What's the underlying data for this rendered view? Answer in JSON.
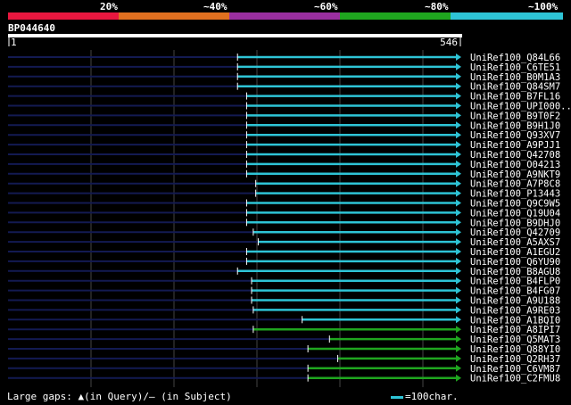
{
  "colors": {
    "seg_red": "#e8173f",
    "seg_orange": "#e07020",
    "seg_purple": "#9a2fa0",
    "seg_green": "#1fa61f",
    "seg_cyan": "#2ec4d6",
    "query_line": "#ffffff",
    "faint_line": "#131a52",
    "hit_cyan": "#2ec4d6",
    "hit_green": "#1fa61f",
    "grid": "#444444"
  },
  "scale": {
    "labels": [
      "20%",
      "~40%",
      "~60%",
      "~80%",
      "~100%"
    ]
  },
  "query": {
    "id": "BP044640",
    "start_label": "1",
    "end_label": "546",
    "length": 546
  },
  "hits": [
    {
      "name": "UniRef100_Q84L66",
      "start": 277,
      "end": 546,
      "color": "cyan"
    },
    {
      "name": "UniRef100_C6TE51",
      "start": 277,
      "end": 546,
      "color": "cyan"
    },
    {
      "name": "UniRef100_B0M1A3",
      "start": 277,
      "end": 546,
      "color": "cyan"
    },
    {
      "name": "UniRef100_Q84SM7",
      "start": 277,
      "end": 546,
      "color": "cyan"
    },
    {
      "name": "UniRef100_B7FL16",
      "start": 288,
      "end": 546,
      "color": "cyan"
    },
    {
      "name": "UniRef100_UPI000..",
      "start": 288,
      "end": 546,
      "color": "cyan"
    },
    {
      "name": "UniRef100_B9T0F2",
      "start": 288,
      "end": 546,
      "color": "cyan"
    },
    {
      "name": "UniRef100_B9H1J0",
      "start": 288,
      "end": 546,
      "color": "cyan"
    },
    {
      "name": "UniRef100_Q93XV7",
      "start": 288,
      "end": 546,
      "color": "cyan"
    },
    {
      "name": "UniRef100_A9PJJ1",
      "start": 288,
      "end": 546,
      "color": "cyan"
    },
    {
      "name": "UniRef100_Q42708",
      "start": 288,
      "end": 546,
      "color": "cyan"
    },
    {
      "name": "UniRef100_O04213",
      "start": 288,
      "end": 546,
      "color": "cyan"
    },
    {
      "name": "UniRef100_A9NKT9",
      "start": 288,
      "end": 546,
      "color": "cyan"
    },
    {
      "name": "UniRef100_A7P8C8",
      "start": 299,
      "end": 546,
      "color": "cyan"
    },
    {
      "name": "UniRef100_P13443",
      "start": 299,
      "end": 546,
      "color": "cyan"
    },
    {
      "name": "UniRef100_Q9C9W5",
      "start": 288,
      "end": 546,
      "color": "cyan"
    },
    {
      "name": "UniRef100_Q19U04",
      "start": 288,
      "end": 546,
      "color": "cyan"
    },
    {
      "name": "UniRef100_B9DHJ0",
      "start": 288,
      "end": 546,
      "color": "cyan"
    },
    {
      "name": "UniRef100_Q42709",
      "start": 296,
      "end": 546,
      "color": "cyan"
    },
    {
      "name": "UniRef100_A5AXS7",
      "start": 302,
      "end": 546,
      "color": "cyan"
    },
    {
      "name": "UniRef100_A1EGU2",
      "start": 288,
      "end": 546,
      "color": "cyan"
    },
    {
      "name": "UniRef100_Q6YU90",
      "start": 288,
      "end": 546,
      "color": "cyan"
    },
    {
      "name": "UniRef100_B8AGU8",
      "start": 277,
      "end": 546,
      "color": "cyan"
    },
    {
      "name": "UniRef100_B4FLP0",
      "start": 294,
      "end": 546,
      "color": "cyan"
    },
    {
      "name": "UniRef100_B4FG07",
      "start": 294,
      "end": 546,
      "color": "cyan"
    },
    {
      "name": "UniRef100_A9U188",
      "start": 294,
      "end": 546,
      "color": "cyan"
    },
    {
      "name": "UniRef100_A9RE03",
      "start": 296,
      "end": 546,
      "color": "cyan"
    },
    {
      "name": "UniRef100_A1BQI0",
      "start": 355,
      "end": 546,
      "color": "cyan"
    },
    {
      "name": "UniRef100_A8IPI7",
      "start": 296,
      "end": 546,
      "color": "green"
    },
    {
      "name": "UniRef100_Q5MAT3",
      "start": 388,
      "end": 546,
      "color": "green"
    },
    {
      "name": "UniRef100_Q88YI0",
      "start": 362,
      "end": 546,
      "color": "green"
    },
    {
      "name": "UniRef100_Q2RH37",
      "start": 398,
      "end": 546,
      "color": "green"
    },
    {
      "name": "UniRef100_C6VM87",
      "start": 362,
      "end": 546,
      "color": "green"
    },
    {
      "name": "UniRef100_C2FMU8",
      "start": 362,
      "end": 546,
      "color": "green"
    }
  ],
  "legend": {
    "large_gaps_label": "Large gaps:",
    "query_gap_text": "(in Query)/",
    "subject_gap_symbol": "–",
    "subject_gap_text": "(in Subject)",
    "scale_text": "=100char."
  }
}
